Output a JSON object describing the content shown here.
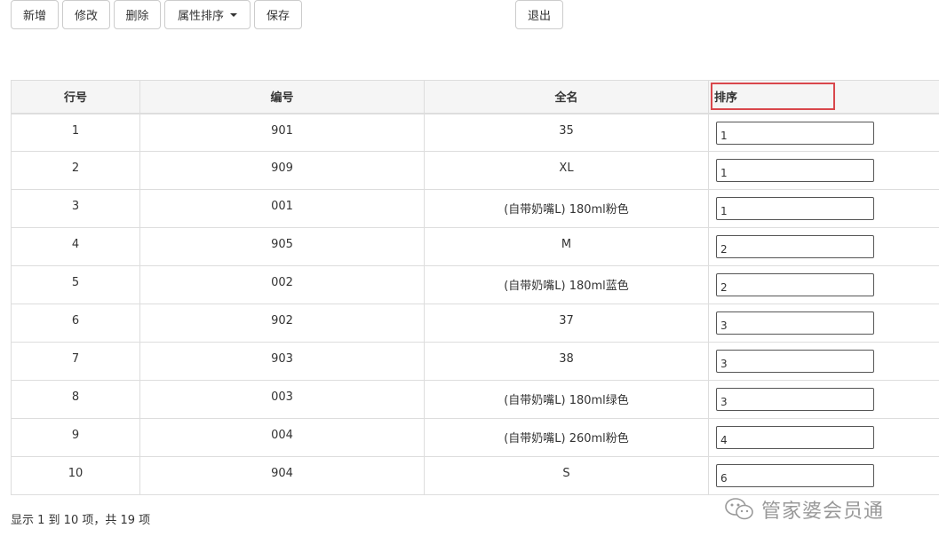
{
  "toolbar": {
    "add_label": "新增",
    "edit_label": "修改",
    "delete_label": "删除",
    "sort_label": "属性排序",
    "save_label": "保存",
    "exit_label": "退出"
  },
  "table": {
    "headers": {
      "row_no": "行号",
      "code": "编号",
      "name": "全名",
      "sort": "排序"
    },
    "rows": [
      {
        "row_no": "1",
        "code": "901",
        "name": "35",
        "sort": "1"
      },
      {
        "row_no": "2",
        "code": "909",
        "name": "XL",
        "sort": "1"
      },
      {
        "row_no": "3",
        "code": "001",
        "name": "(自带奶嘴L) 180ml粉色",
        "sort": "1"
      },
      {
        "row_no": "4",
        "code": "905",
        "name": "M",
        "sort": "2"
      },
      {
        "row_no": "5",
        "code": "002",
        "name": "(自带奶嘴L) 180ml蓝色",
        "sort": "2"
      },
      {
        "row_no": "6",
        "code": "902",
        "name": "37",
        "sort": "3"
      },
      {
        "row_no": "7",
        "code": "903",
        "name": "38",
        "sort": "3"
      },
      {
        "row_no": "8",
        "code": "003",
        "name": "(自带奶嘴L) 180ml绿色",
        "sort": "3"
      },
      {
        "row_no": "9",
        "code": "004",
        "name": "(自带奶嘴L) 260ml粉色",
        "sort": "4"
      },
      {
        "row_no": "10",
        "code": "904",
        "name": "S",
        "sort": "6"
      }
    ]
  },
  "pagination": {
    "info": "显示 1 到 10 项，共 19 项"
  },
  "watermark": {
    "text": "管家婆会员通",
    "icon": "wechat-icon"
  },
  "colors": {
    "highlight": "#d9474c",
    "header_bg": "#f5f5f5",
    "border": "#dddddd"
  }
}
